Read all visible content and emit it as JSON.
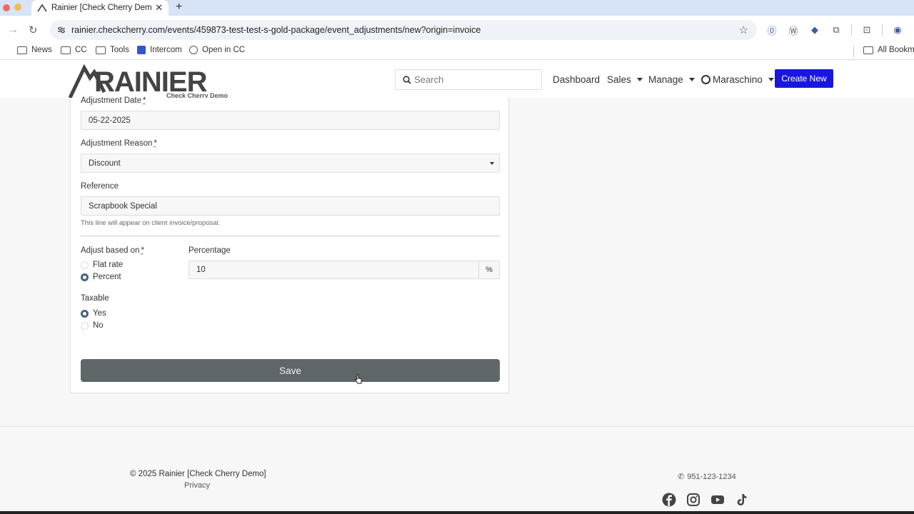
{
  "browser": {
    "tab_title": "Rainier [Check Cherry Demo]",
    "url": "rainier.checkcherry.com/events/459873-test-test-s-gold-package/event_adjustments/new?origin=invoice",
    "bookmarks": [
      "News",
      "CC",
      "Tools",
      "Intercom",
      "Open in CC"
    ],
    "all_bookmarks_label": "All Bookma"
  },
  "header": {
    "logo_text": "RAINIER",
    "logo_sub": "Check Cherry Demo",
    "search_placeholder": "Search",
    "nav": {
      "dashboard": "Dashboard",
      "sales": "Sales",
      "manage": "Manage",
      "user": "Maraschino"
    },
    "create_new": "Create New",
    "accent_color": "#1a16e0"
  },
  "form": {
    "adjustment_date_label": "Adjustment Date",
    "adjustment_date_value": "05-22-2025",
    "adjustment_reason_label": "Adjustment Reason",
    "adjustment_reason_value": "Discount",
    "reference_label": "Reference",
    "reference_value": "Scrapbook Special",
    "reference_help": "This line will appear on client invoice/proposal.",
    "adjust_based_on_label": "Adjust based on",
    "adjust_options": [
      "Flat rate",
      "Percent"
    ],
    "adjust_selected": "Percent",
    "percentage_label": "Percentage",
    "percentage_value": "10",
    "percent_symbol": "%",
    "taxable_label": "Taxable",
    "taxable_options": [
      "Yes",
      "No"
    ],
    "taxable_selected": "Yes",
    "required_marker": "*",
    "save_label": "Save"
  },
  "footer": {
    "copyright": "© 2025 Rainier [Check Cherry Demo]",
    "privacy": "Privacy",
    "phone": "951-123-1234",
    "social": [
      "facebook-icon",
      "instagram-icon",
      "youtube-icon",
      "tiktok-icon"
    ]
  }
}
